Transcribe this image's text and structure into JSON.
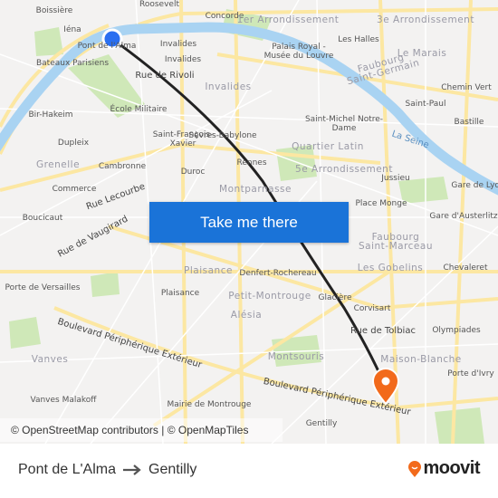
{
  "map": {
    "labels": [
      {
        "text": "Boissière",
        "kind": "place"
      },
      {
        "text": "Roosevelt",
        "kind": "place"
      },
      {
        "text": "Concorde",
        "kind": "place"
      },
      {
        "text": "1er Arrondissement",
        "kind": "district"
      },
      {
        "text": "3e Arrondissement",
        "kind": "district"
      },
      {
        "text": "Iéna",
        "kind": "place"
      },
      {
        "text": "Pont de l'Alma",
        "kind": "place"
      },
      {
        "text": "Invalides",
        "kind": "place"
      },
      {
        "text": "Palais Royal - Musée du Louvre",
        "kind": "place"
      },
      {
        "text": "Les Halles",
        "kind": "place"
      },
      {
        "text": "Le Marais",
        "kind": "district"
      },
      {
        "text": "Bateaux Parisiens",
        "kind": "place"
      },
      {
        "text": "Invalides",
        "kind": "place"
      },
      {
        "text": "Rue de Rivoli",
        "kind": "street"
      },
      {
        "text": "Invalides",
        "kind": "district"
      },
      {
        "text": "Faubourg Saint-Germain",
        "kind": "district"
      },
      {
        "text": "Chemin Vert",
        "kind": "place"
      },
      {
        "text": "Saint-Paul",
        "kind": "place"
      },
      {
        "text": "Bir-Hakeim",
        "kind": "place"
      },
      {
        "text": "École Militaire",
        "kind": "place"
      },
      {
        "text": "Saint-Michel Notre-Dame",
        "kind": "place"
      },
      {
        "text": "Bastille",
        "kind": "place"
      },
      {
        "text": "La Seine",
        "kind": "river"
      },
      {
        "text": "Saint-François-Xavier",
        "kind": "place"
      },
      {
        "text": "Sèvres-Babylone",
        "kind": "place"
      },
      {
        "text": "Quartier Latin",
        "kind": "district"
      },
      {
        "text": "Dupleix",
        "kind": "place"
      },
      {
        "text": "Grenelle",
        "kind": "district"
      },
      {
        "text": "Cambronne",
        "kind": "place"
      },
      {
        "text": "Duroc",
        "kind": "place"
      },
      {
        "text": "Rennes",
        "kind": "place"
      },
      {
        "text": "5e Arrondissement",
        "kind": "district"
      },
      {
        "text": "Jussieu",
        "kind": "place"
      },
      {
        "text": "Gare de Lyon",
        "kind": "place"
      },
      {
        "text": "Commerce",
        "kind": "place"
      },
      {
        "text": "Rue Lecourbe",
        "kind": "street"
      },
      {
        "text": "Montparnasse",
        "kind": "district"
      },
      {
        "text": "Place Monge",
        "kind": "place"
      },
      {
        "text": "Boucicaut",
        "kind": "place"
      },
      {
        "text": "Rue de Vaugirard",
        "kind": "street"
      },
      {
        "text": "Gare d'Austerlitz",
        "kind": "place"
      },
      {
        "text": "Faubourg Saint-Marceau",
        "kind": "district"
      },
      {
        "text": "Plaisance",
        "kind": "district"
      },
      {
        "text": "Denfert-Rochereau",
        "kind": "place"
      },
      {
        "text": "Les Gobelins",
        "kind": "district"
      },
      {
        "text": "Chevaleret",
        "kind": "place"
      },
      {
        "text": "Porte de Versailles",
        "kind": "place"
      },
      {
        "text": "Plaisance",
        "kind": "place"
      },
      {
        "text": "Petit-Montrouge",
        "kind": "district"
      },
      {
        "text": "Glacière",
        "kind": "place"
      },
      {
        "text": "Corvisart",
        "kind": "place"
      },
      {
        "text": "Alésia",
        "kind": "district"
      },
      {
        "text": "Boulevard Périphérique Extérieur",
        "kind": "street"
      },
      {
        "text": "Rue de Tolbiac",
        "kind": "street"
      },
      {
        "text": "Olympiades",
        "kind": "place"
      },
      {
        "text": "Vanves",
        "kind": "district"
      },
      {
        "text": "Montsouris",
        "kind": "district"
      },
      {
        "text": "Maison-Blanche",
        "kind": "district"
      },
      {
        "text": "Porte d'Ivry",
        "kind": "place"
      },
      {
        "text": "Vanves Malakoff",
        "kind": "place"
      },
      {
        "text": "Mairie de Montrouge",
        "kind": "place"
      },
      {
        "text": "Boulevard Périphérique Extérieur",
        "kind": "street"
      },
      {
        "text": "Gentilly",
        "kind": "place"
      }
    ],
    "origin_marker_color": "#2a6ff0",
    "destination_marker_color": "#f26a1b",
    "route_color": "#222222",
    "water_color": "#a9d3f2",
    "park_color": "#c8e6b0",
    "road_color": "#fde9a0"
  },
  "cta": {
    "label": "Take me there",
    "color": "#1a73d8"
  },
  "attribution": "© OpenStreetMap contributors | © OpenMapTiles",
  "footer": {
    "origin": "Pont de L'Alma",
    "arrow_icon": "arrow-right-icon",
    "destination": "Gentilly",
    "logo_text": "moovit",
    "logo_color": "#f26a1b"
  }
}
